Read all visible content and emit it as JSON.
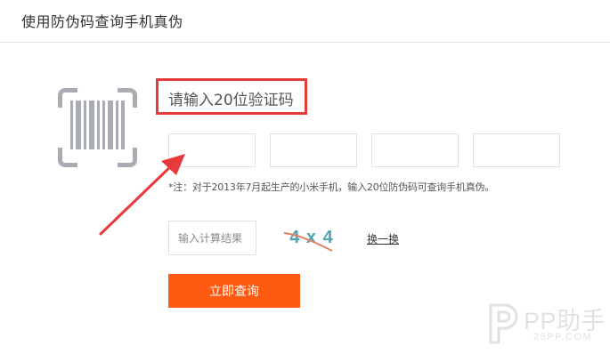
{
  "header": {
    "title": "使用防伪码查询手机真伪"
  },
  "icons": {
    "barcode": "barcode-scan-icon",
    "arrow": "red-arrow-annotation",
    "watermark": "pp-assistant-logo"
  },
  "verify": {
    "prompt": "请输入20位验证码",
    "code_inputs": [
      {
        "value": "",
        "placeholder": ""
      },
      {
        "value": "",
        "placeholder": ""
      },
      {
        "value": "",
        "placeholder": ""
      },
      {
        "value": "",
        "placeholder": ""
      }
    ],
    "note": "*注：对于2013年7月起生产的小米手机，输入20位防伪码可查询手机真伪。"
  },
  "captcha": {
    "input_placeholder": "输入计算结果",
    "input_value": "",
    "expression": "4 x 4",
    "refresh_label": "换一换"
  },
  "submit": {
    "label": "立即查询"
  },
  "watermark": {
    "main": "PP助手",
    "sub": "25PP.COM"
  },
  "colors": {
    "accent_button": "#ff5a12",
    "highlight_border": "#e33a3a",
    "arrow": "#e83a3a",
    "captcha_text": "#4fa3b3",
    "captcha_strike": "#e08060"
  }
}
